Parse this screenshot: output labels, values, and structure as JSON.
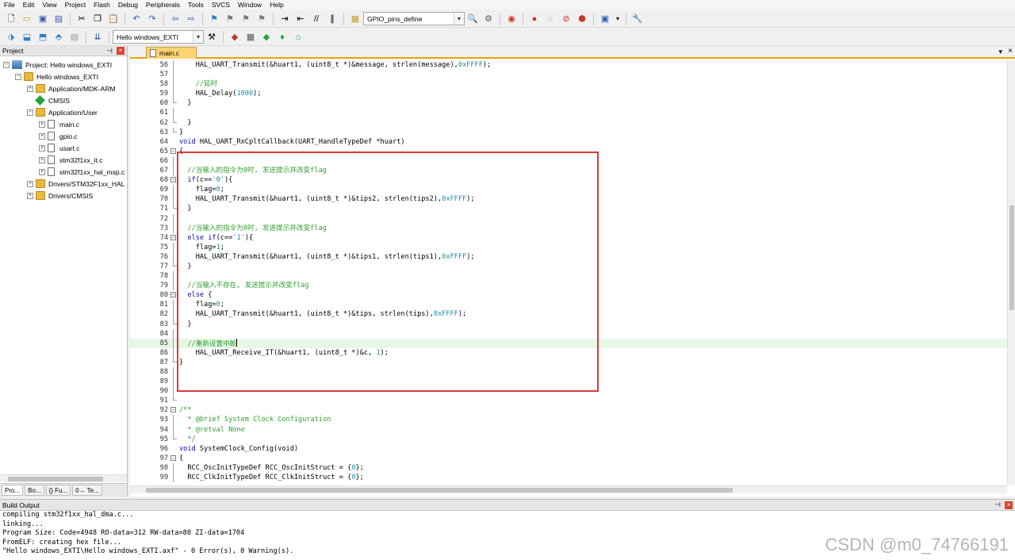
{
  "menu": [
    "File",
    "Edit",
    "View",
    "Project",
    "Flash",
    "Debug",
    "Peripherals",
    "Tools",
    "SVCS",
    "Window",
    "Help"
  ],
  "toolbar1": {
    "target_combo": "GPIO_pins_define",
    "icons": [
      "new-file-icon",
      "open-icon",
      "save-icon",
      "save-all-icon",
      "cut-icon",
      "copy-icon",
      "paste-icon",
      "undo-icon",
      "redo-icon",
      "back-icon",
      "forward-icon",
      "bookmark-icon",
      "prev-bookmark-icon",
      "next-bookmark-icon",
      "clear-bookmarks-icon",
      "indent-icon",
      "unindent-icon",
      "comment-icon",
      "uncomment-icon",
      "find-in-files-icon",
      "find-icon",
      "debug-start-icon",
      "breakpoint-icon",
      "disable-breakpoint-icon",
      "kill-breakpoint-icon",
      "clear-breakpoints-icon",
      "window-layout-icon",
      "configure-icon"
    ]
  },
  "toolbar2": {
    "target_combo": "Hello windows_EXTI",
    "icons": [
      "translate-icon",
      "build-icon",
      "rebuild-icon",
      "batch-build-icon",
      "download-icon",
      "options-for-target-icon",
      "manage-components-icon",
      "pack-installer-icon",
      "select-packs-icon",
      "event-recorder-icon"
    ]
  },
  "project_panel": {
    "title": "Project",
    "pin": "ᵖ",
    "close": "×",
    "tree": [
      {
        "label": "Project: Hello windows_EXTI",
        "level": 0,
        "icon": "project",
        "expander": "−"
      },
      {
        "label": "Hello windows_EXTI",
        "level": 1,
        "icon": "folder",
        "expander": "−"
      },
      {
        "label": "Application/MDK-ARM",
        "level": 2,
        "icon": "folder",
        "expander": "+"
      },
      {
        "label": "CMSIS",
        "level": 2,
        "icon": "diamond",
        "expander": ""
      },
      {
        "label": "Application/User",
        "level": 2,
        "icon": "folder",
        "expander": "−"
      },
      {
        "label": "main.c",
        "level": 3,
        "icon": "file",
        "expander": "+"
      },
      {
        "label": "gpio.c",
        "level": 3,
        "icon": "file",
        "expander": "+"
      },
      {
        "label": "usart.c",
        "level": 3,
        "icon": "file",
        "expander": "+"
      },
      {
        "label": "stm32f1xx_it.c",
        "level": 3,
        "icon": "file",
        "expander": "+"
      },
      {
        "label": "stm32f1xx_hal_msp.c",
        "level": 3,
        "icon": "file",
        "expander": "+"
      },
      {
        "label": "Drivers/STM32F1xx_HAL",
        "level": 2,
        "icon": "folder",
        "expander": "+"
      },
      {
        "label": "Drivers/CMSIS",
        "level": 2,
        "icon": "folder",
        "expander": "+"
      }
    ],
    "tabs": [
      "Pro...",
      "Bo...",
      "{} Fu...",
      "0→ Te..."
    ]
  },
  "editor": {
    "tab_label": "main.c",
    "current_line": 85,
    "lines": [
      {
        "n": 56,
        "fold": "vl",
        "parts": [
          [
            "",
            "    HAL_UART_Transmit(&huart1, (uint8_t *)&message, strlen(message),"
          ],
          [
            "num",
            "0xFFFF"
          ],
          [
            "",
            ");"
          ]
        ]
      },
      {
        "n": 57,
        "fold": "vl",
        "parts": []
      },
      {
        "n": 58,
        "fold": "vl",
        "parts": [
          [
            "cm",
            "    //延时"
          ]
        ]
      },
      {
        "n": 59,
        "fold": "vl",
        "parts": [
          [
            "",
            "    HAL_Delay("
          ],
          [
            "num",
            "1000"
          ],
          [
            "",
            ");"
          ]
        ]
      },
      {
        "n": 60,
        "fold": "end",
        "parts": [
          [
            "",
            "  }"
          ]
        ]
      },
      {
        "n": 61,
        "fold": "vl",
        "parts": []
      },
      {
        "n": 62,
        "fold": "end",
        "parts": [
          [
            "",
            "  }"
          ]
        ]
      },
      {
        "n": 63,
        "fold": "end",
        "parts": [
          [
            "",
            "}"
          ]
        ]
      },
      {
        "n": 64,
        "fold": "",
        "parts": [
          [
            "kw",
            "void"
          ],
          [
            "",
            " HAL_UART_RxCpltCallback(UART_HandleTypeDef *huart)"
          ]
        ]
      },
      {
        "n": 65,
        "fold": "box",
        "parts": [
          [
            "",
            "{"
          ]
        ]
      },
      {
        "n": 66,
        "fold": "vl",
        "parts": []
      },
      {
        "n": 67,
        "fold": "vl",
        "parts": [
          [
            "cm",
            "  //当输入的指令为0时, 发送提示并改变flag"
          ]
        ]
      },
      {
        "n": 68,
        "fold": "box",
        "parts": [
          [
            "",
            "  "
          ],
          [
            "kw",
            "if"
          ],
          [
            "",
            "(c=="
          ],
          [
            "num",
            "'0'"
          ],
          [
            "",
            "){"
          ]
        ]
      },
      {
        "n": 69,
        "fold": "vl",
        "parts": [
          [
            "",
            "    flag="
          ],
          [
            "num",
            "0"
          ],
          [
            "",
            ";"
          ]
        ]
      },
      {
        "n": 70,
        "fold": "vl",
        "parts": [
          [
            "",
            "    HAL_UART_Transmit(&huart1, (uint8_t *)&tips2, strlen(tips2),"
          ],
          [
            "num",
            "0xFFFF"
          ],
          [
            "",
            ");"
          ]
        ]
      },
      {
        "n": 71,
        "fold": "end",
        "parts": [
          [
            "",
            "  }"
          ]
        ]
      },
      {
        "n": 72,
        "fold": "vl",
        "parts": []
      },
      {
        "n": 73,
        "fold": "vl",
        "parts": [
          [
            "cm",
            "  //当输入的指令为0时, 发送提示并改变flag"
          ]
        ]
      },
      {
        "n": 74,
        "fold": "box",
        "parts": [
          [
            "",
            "  "
          ],
          [
            "kw",
            "else if"
          ],
          [
            "",
            "(c=="
          ],
          [
            "num",
            "'1'"
          ],
          [
            "",
            "){"
          ]
        ]
      },
      {
        "n": 75,
        "fold": "vl",
        "parts": [
          [
            "",
            "    flag="
          ],
          [
            "num",
            "1"
          ],
          [
            "",
            ";"
          ]
        ]
      },
      {
        "n": 76,
        "fold": "vl",
        "parts": [
          [
            "",
            "    HAL_UART_Transmit(&huart1, (uint8_t *)&tips1, strlen(tips1),"
          ],
          [
            "num",
            "0xFFFF"
          ],
          [
            "",
            ");"
          ]
        ]
      },
      {
        "n": 77,
        "fold": "end",
        "parts": [
          [
            "",
            "  }"
          ]
        ]
      },
      {
        "n": 78,
        "fold": "vl",
        "parts": []
      },
      {
        "n": 79,
        "fold": "vl",
        "parts": [
          [
            "cm",
            "  //当输入不存在, 发送提示并改变flag"
          ]
        ]
      },
      {
        "n": 80,
        "fold": "box",
        "parts": [
          [
            "",
            "  "
          ],
          [
            "kw",
            "else"
          ],
          [
            "",
            " {"
          ]
        ]
      },
      {
        "n": 81,
        "fold": "vl",
        "parts": [
          [
            "",
            "    flag="
          ],
          [
            "num",
            "0"
          ],
          [
            "",
            ";"
          ]
        ]
      },
      {
        "n": 82,
        "fold": "vl",
        "parts": [
          [
            "",
            "    HAL_UART_Transmit(&huart1, (uint8_t *)&tips, strlen(tips),"
          ],
          [
            "num",
            "0xFFFF"
          ],
          [
            "",
            ");"
          ]
        ]
      },
      {
        "n": 83,
        "fold": "end",
        "parts": [
          [
            "",
            "  }"
          ]
        ]
      },
      {
        "n": 84,
        "fold": "vl",
        "parts": []
      },
      {
        "n": 85,
        "fold": "vl",
        "parts": [
          [
            "cm",
            "  //重新设置中断"
          ]
        ]
      },
      {
        "n": 86,
        "fold": "vl",
        "parts": [
          [
            "",
            "    HAL_UART_Receive_IT(&huart1, (uint8_t *)&c, "
          ],
          [
            "num",
            "1"
          ],
          [
            "",
            ");"
          ]
        ]
      },
      {
        "n": 87,
        "fold": "end",
        "parts": [
          [
            "",
            "}"
          ]
        ]
      },
      {
        "n": 88,
        "fold": "vl",
        "parts": []
      },
      {
        "n": 89,
        "fold": "vl",
        "parts": []
      },
      {
        "n": 90,
        "fold": "vl",
        "parts": []
      },
      {
        "n": 91,
        "fold": "end",
        "parts": []
      },
      {
        "n": 92,
        "fold": "box",
        "parts": [
          [
            "cm",
            "/**"
          ]
        ]
      },
      {
        "n": 93,
        "fold": "vl",
        "parts": [
          [
            "cm",
            "  * @brief System Clock Configuration"
          ]
        ]
      },
      {
        "n": 94,
        "fold": "vl",
        "parts": [
          [
            "cm",
            "  * @retval None"
          ]
        ]
      },
      {
        "n": 95,
        "fold": "end",
        "parts": [
          [
            "cm",
            "  */"
          ]
        ]
      },
      {
        "n": 96,
        "fold": "",
        "parts": [
          [
            "kw",
            "void"
          ],
          [
            "",
            " SystemClock_Config(void)"
          ]
        ]
      },
      {
        "n": 97,
        "fold": "box",
        "parts": [
          [
            "",
            "{"
          ]
        ]
      },
      {
        "n": 98,
        "fold": "vl",
        "parts": [
          [
            "",
            "  RCC_OscInitTypeDef RCC_OscInitStruct = {"
          ],
          [
            "num",
            "0"
          ],
          [
            "",
            "};"
          ]
        ]
      },
      {
        "n": 99,
        "fold": "vl",
        "parts": [
          [
            "",
            "  RCC_ClkInitTypeDef RCC_ClkInitStruct = {"
          ],
          [
            "num",
            "0"
          ],
          [
            "",
            "};"
          ]
        ]
      }
    ]
  },
  "build_output": {
    "title": "Build Output",
    "lines": [
      "compiling stm32f1xx_hal_dma.c...",
      "linking...",
      "Program Size: Code=4948 RO-data=312 RW-data=80 ZI-data=1704",
      "FromELF: creating hex file...",
      "\"Hello windows_EXTI\\Hello windows_EXTI.axf\" - 0 Error(s), 0 Warning(s)."
    ]
  },
  "watermark": "CSDN @m0_74766191"
}
